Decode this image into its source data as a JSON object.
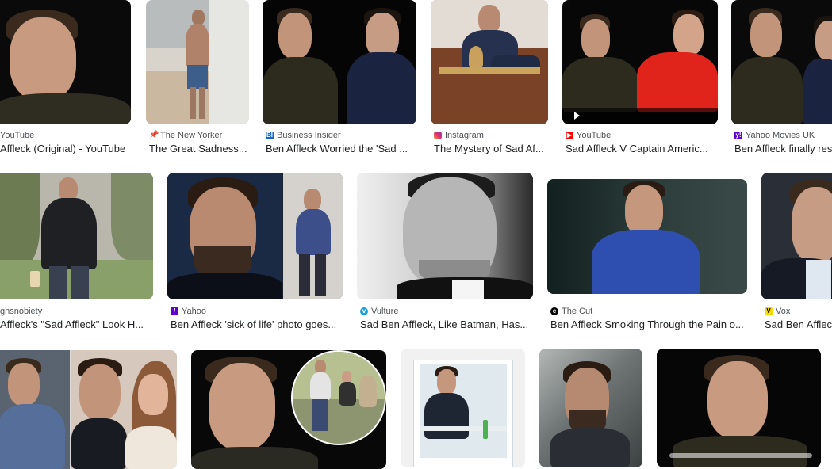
{
  "results": [
    {
      "source": "YouTube",
      "title": "Affleck (Original) - YouTube",
      "favicon": "youtube-icon",
      "color": "#ff0000"
    },
    {
      "source": "The New Yorker",
      "title": "The Great Sadness...",
      "favicon": "pin-icon",
      "color": "#333333"
    },
    {
      "source": "Business Insider",
      "title": "Ben Affleck Worried the 'Sad ...",
      "favicon": "bi-icon",
      "color": "#1565c0"
    },
    {
      "source": "Instagram",
      "title": "The Mystery of Sad Af...",
      "favicon": "instagram-icon",
      "color": "#e1306c"
    },
    {
      "source": "YouTube",
      "title": "Sad Affleck V Captain Americ...",
      "favicon": "youtube-icon",
      "color": "#ff0000"
    },
    {
      "source": "Yahoo Movies UK",
      "title": "Ben Affleck finally res",
      "favicon": "yahoo-icon",
      "color": "#6001d2"
    },
    {
      "source": "ghsnobiety",
      "title": "Affleck's \"Sad Affleck\" Look H...",
      "favicon": "none",
      "color": "#000000"
    },
    {
      "source": "Yahoo",
      "title": "Ben Affleck 'sick of life' photo goes...",
      "favicon": "yahoo-icon",
      "color": "#6001d2"
    },
    {
      "source": "Vulture",
      "title": "Sad Ben Affleck, Like Batman, Has...",
      "favicon": "vulture-icon",
      "color": "#1ba1d8"
    },
    {
      "source": "The Cut",
      "title": "Ben Affleck Smoking Through the Pain o...",
      "favicon": "thecut-icon",
      "color": "#000000"
    },
    {
      "source": "Vox",
      "title": "Sad Ben Afflec",
      "favicon": "vox-icon",
      "color": "#f6dd00"
    }
  ]
}
